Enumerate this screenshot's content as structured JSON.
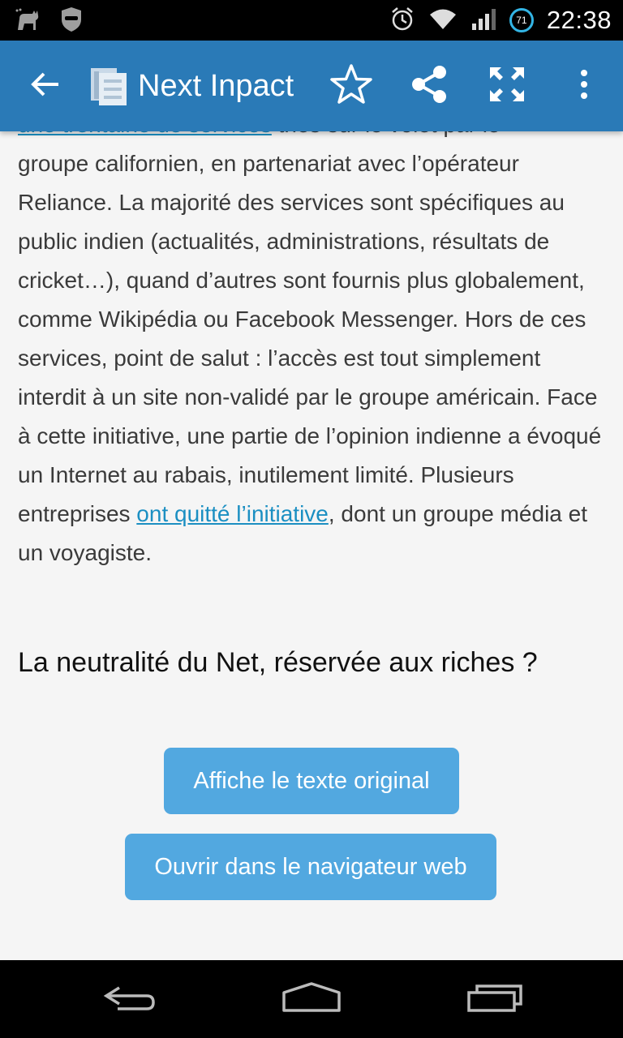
{
  "status_bar": {
    "time": "22:38",
    "battery_level": "71",
    "icons": [
      "cat-icon",
      "incognito-icon",
      "alarm-icon",
      "wifi-icon",
      "signal-icon",
      "battery-icon"
    ]
  },
  "app_bar": {
    "title": "Next Inpact",
    "color": "#2a7ab7",
    "icons": [
      "back-arrow-icon",
      "app-logo-icon",
      "star-icon",
      "share-icon",
      "fullscreen-icon",
      "more-vert-icon"
    ]
  },
  "article": {
    "line0_link": "une trentaine de services",
    "line0_rest": " triés sur le volet par le",
    "paragraph_before_link": "groupe californien, en partenariat avec l’opérateur Reliance. La majorité des services sont spécifiques au public indien (actualités, administrations, résultats de cricket…), quand d’autres sont fournis plus globalement, comme Wikipédia ou Facebook Messenger. Hors de ces services, point de salut : l’accès est tout simplement interdit à un site non-validé par le groupe américain. Face à cette initiative, une partie de l’opinion indienne a évoqué un Internet au rabais, inutilement limité. Plusieurs entreprises ",
    "link_text": "ont quitté l’initiative",
    "paragraph_after_link": ", dont un groupe média et un voyagiste.",
    "link_color": "#1b8fc2",
    "section_heading": "La neutralité du Net, réservée aux riches ?"
  },
  "actions": {
    "show_original": "Affiche le texte original",
    "open_browser": "Ouvrir dans le navigateur web",
    "button_color": "#52a8e0"
  },
  "nav_bar": {
    "icons": [
      "nav-back-icon",
      "nav-home-icon",
      "nav-recents-icon"
    ]
  }
}
